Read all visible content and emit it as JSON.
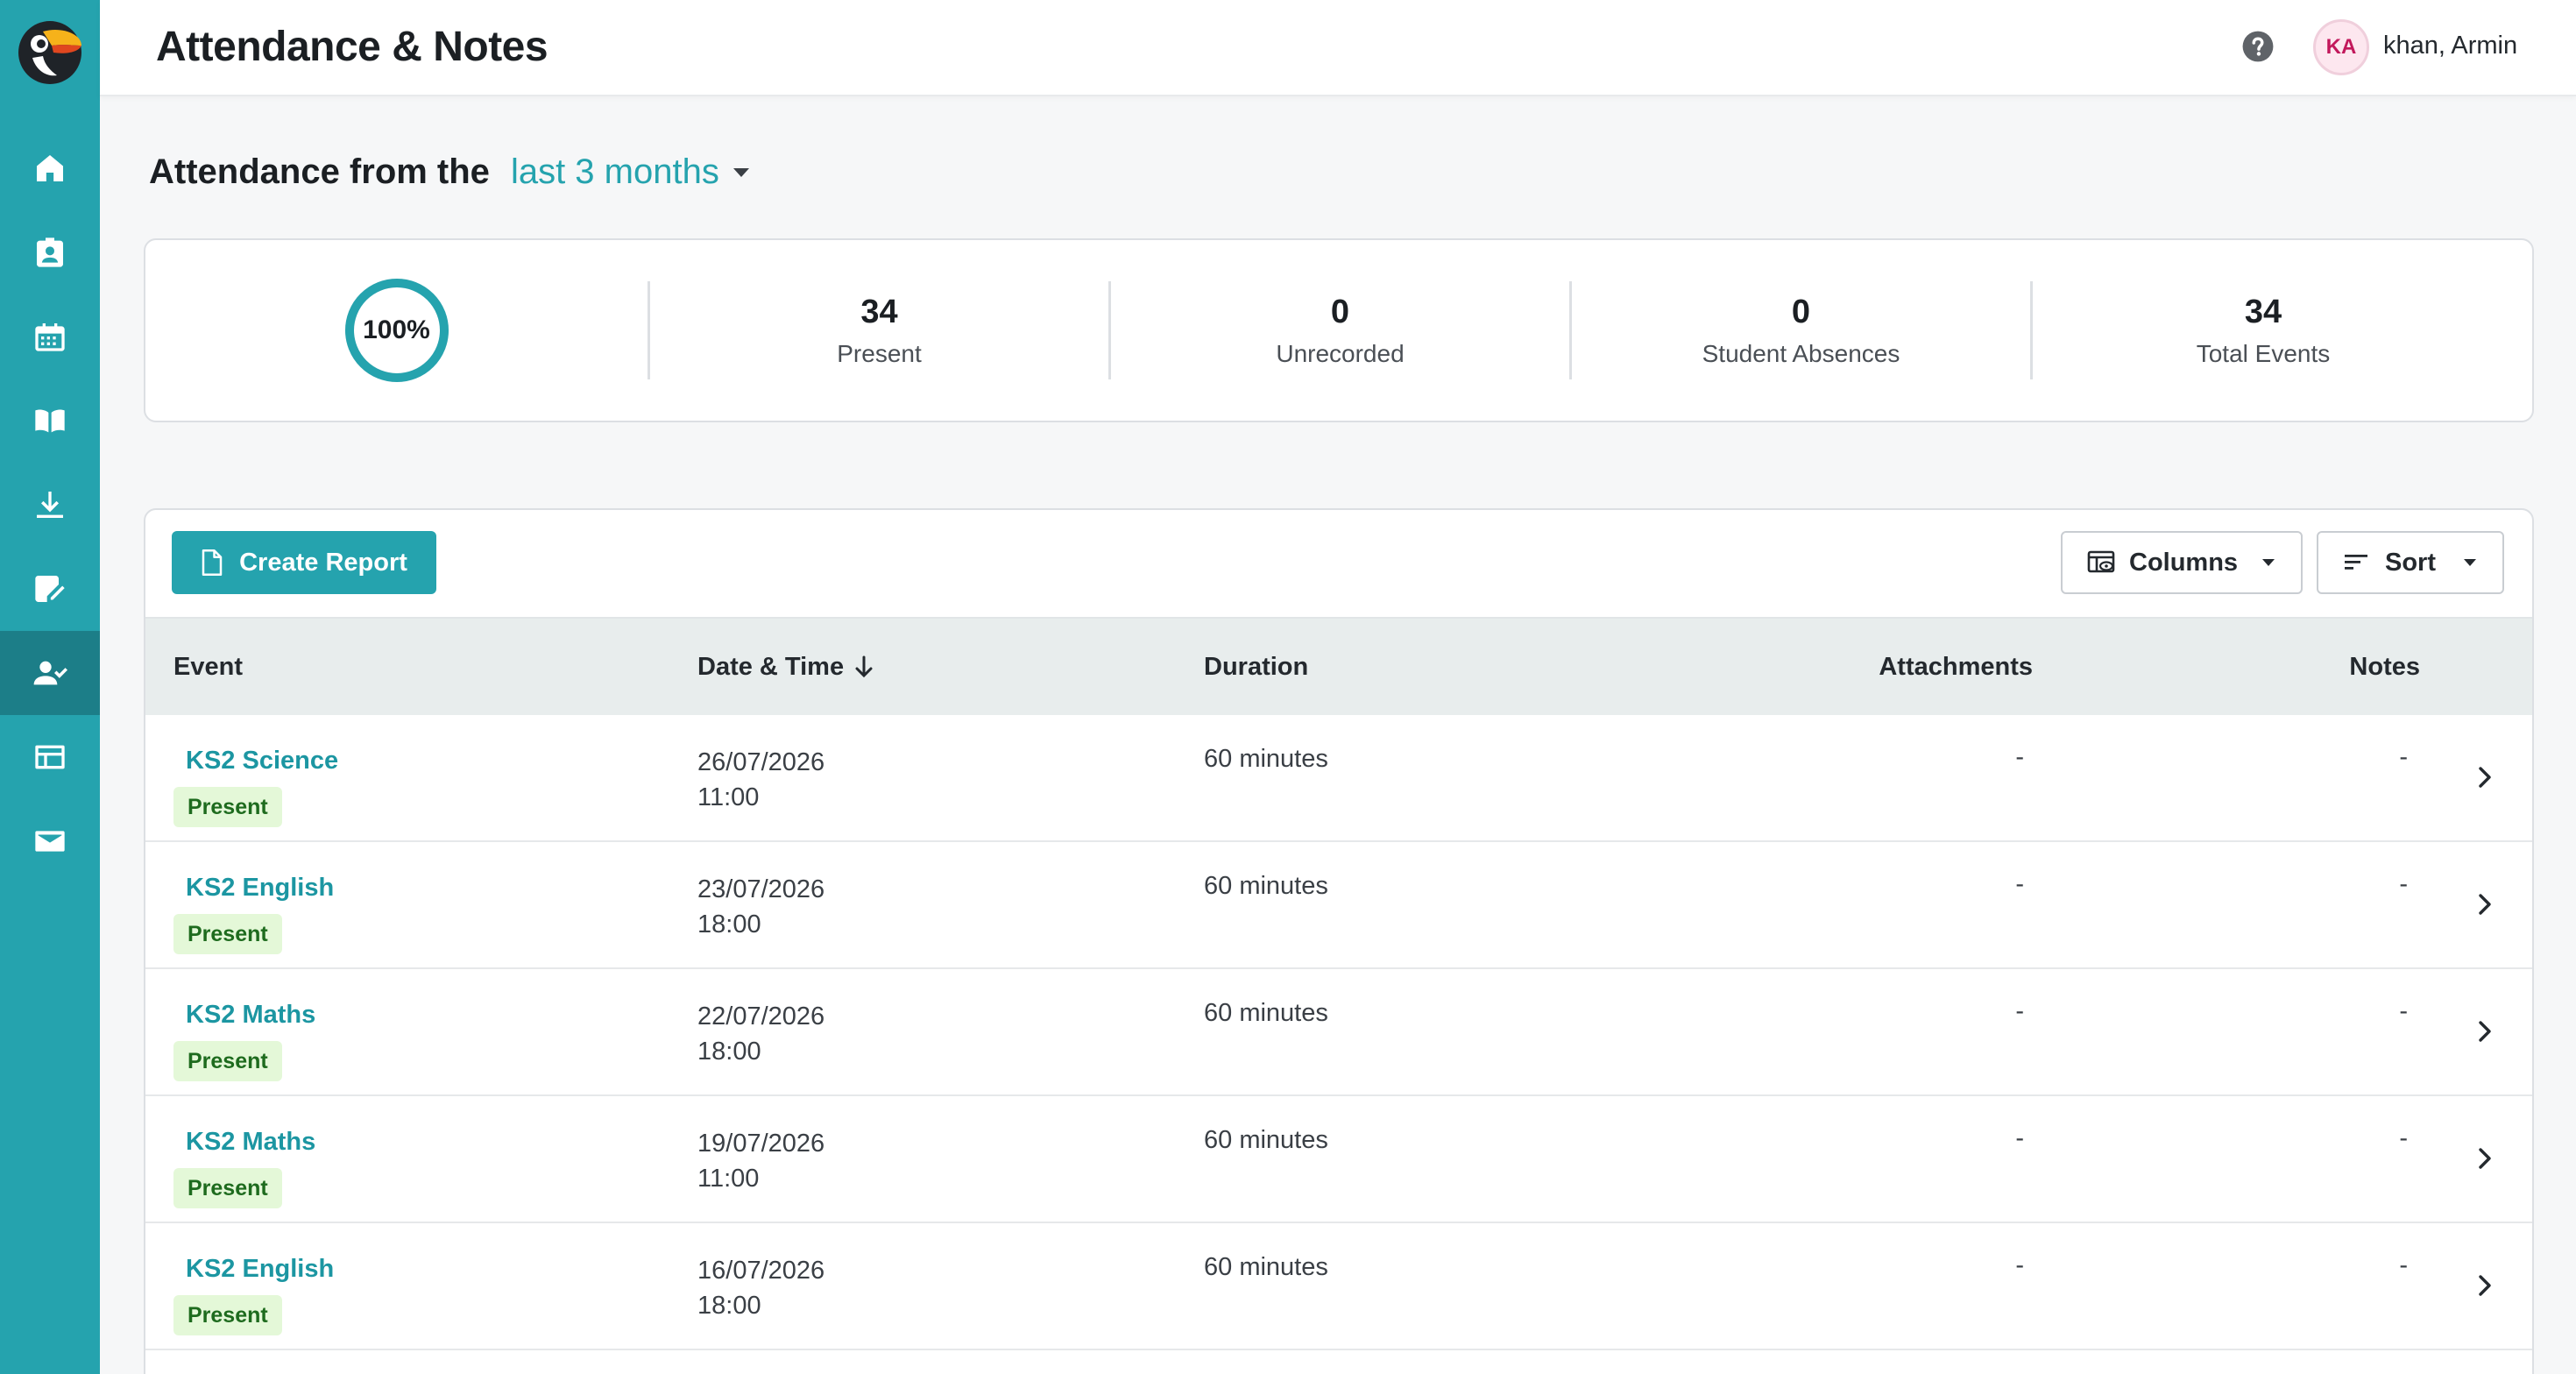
{
  "header": {
    "title": "Attendance & Notes",
    "user": {
      "initials": "KA",
      "name": "khan, Armin"
    }
  },
  "sidebar": {
    "items": [
      {
        "icon": "home-icon"
      },
      {
        "icon": "id-badge-icon"
      },
      {
        "icon": "calendar-icon"
      },
      {
        "icon": "open-book-icon"
      },
      {
        "icon": "download-icon"
      },
      {
        "icon": "notes-edit-icon"
      },
      {
        "icon": "user-check-icon",
        "active": true
      },
      {
        "icon": "table-icon"
      },
      {
        "icon": "mail-icon"
      }
    ]
  },
  "range": {
    "label": "Attendance from the",
    "selected": "last 3 months"
  },
  "summary": {
    "percent_label": "100%",
    "percent_value": 100,
    "present": {
      "value": "34",
      "label": "Present"
    },
    "unrecorded": {
      "value": "0",
      "label": "Unrecorded"
    },
    "absences": {
      "value": "0",
      "label": "Student Absences"
    },
    "total": {
      "value": "34",
      "label": "Total Events"
    }
  },
  "toolbar": {
    "create_report_label": "Create Report",
    "columns_label": "Columns",
    "sort_label": "Sort"
  },
  "table": {
    "headers": {
      "event": "Event",
      "date_time": "Date & Time",
      "duration": "Duration",
      "attachments": "Attachments",
      "notes": "Notes"
    },
    "rows": [
      {
        "event": "KS2 Science",
        "status": "Present",
        "date": "26/07/2026",
        "time": "11:00",
        "duration": "60 minutes",
        "attachments": "-",
        "notes": "-"
      },
      {
        "event": "KS2 English",
        "status": "Present",
        "date": "23/07/2026",
        "time": "18:00",
        "duration": "60 minutes",
        "attachments": "-",
        "notes": "-"
      },
      {
        "event": "KS2 Maths",
        "status": "Present",
        "date": "22/07/2026",
        "time": "18:00",
        "duration": "60 minutes",
        "attachments": "-",
        "notes": "-"
      },
      {
        "event": "KS2 Maths",
        "status": "Present",
        "date": "19/07/2026",
        "time": "11:00",
        "duration": "60 minutes",
        "attachments": "-",
        "notes": "-"
      },
      {
        "event": "KS2 English",
        "status": "Present",
        "date": "16/07/2026",
        "time": "18:00",
        "duration": "60 minutes",
        "attachments": "-",
        "notes": "-"
      }
    ]
  },
  "colors": {
    "brand": "#25a3ae",
    "sidebar_active": "#1c7e88",
    "badge_bg": "#e4f8d8",
    "badge_text": "#1e6b1e"
  }
}
